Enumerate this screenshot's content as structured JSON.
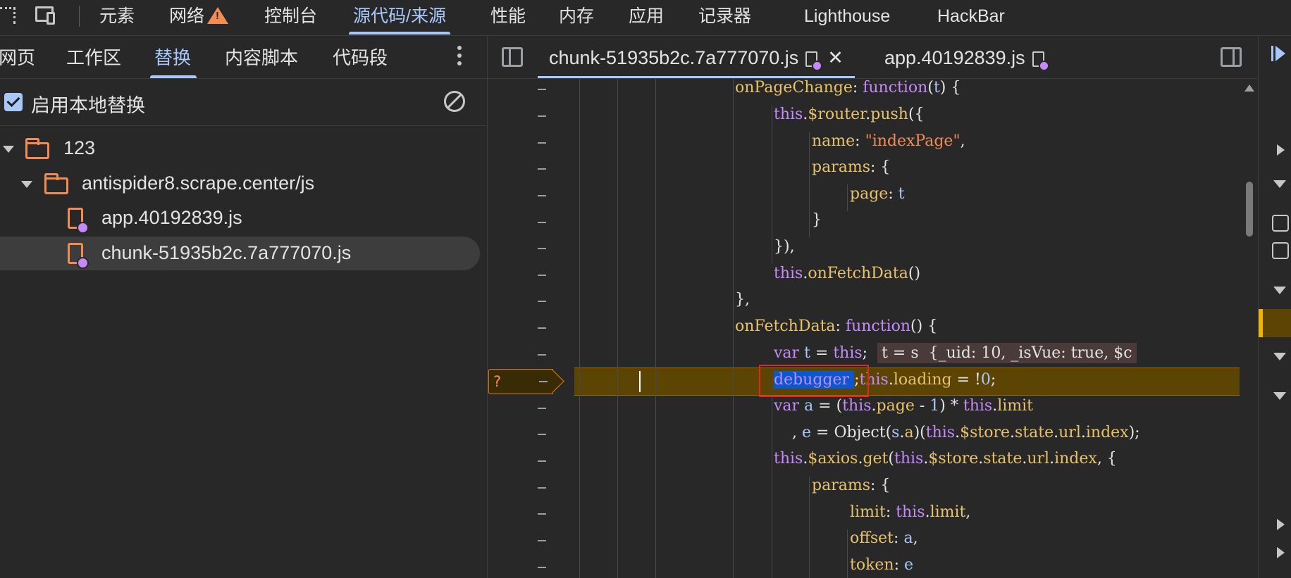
{
  "toolbar": {
    "tabs": [
      "元素",
      "网络",
      "控制台",
      "源代码/来源",
      "性能",
      "内存",
      "应用",
      "记录器",
      "Lighthouse",
      "HackBar"
    ],
    "active_tab": "源代码/来源",
    "network_has_warning": true
  },
  "navigator": {
    "tabs": [
      "网页",
      "工作区",
      "替换",
      "内容脚本",
      "代码段"
    ],
    "active_tab": "替换",
    "enable_label": "启用本地替换",
    "enable_checked": true,
    "tree": [
      {
        "label": "123",
        "type": "folder",
        "expanded": true
      },
      {
        "label": "antispider8.scrape.center/js",
        "type": "folder",
        "expanded": true
      },
      {
        "label": "app.40192839.js",
        "type": "file",
        "modified": true
      },
      {
        "label": "chunk-51935b2c.7a777070.js",
        "type": "file",
        "modified": true,
        "selected": true
      }
    ]
  },
  "editor": {
    "tabs": [
      {
        "label": "chunk-51935b2c.7a777070.js",
        "active": true,
        "closable": true
      },
      {
        "label": "app.40192839.js",
        "active": false,
        "closable": false
      }
    ],
    "gutter_mark": "?",
    "paused_line_index": 11,
    "inline_value_text": "t = s  {_uid: 10, _isVue: true, $c",
    "code_lines": [
      "onPageChange: function(t) {",
      "this.$router.push({",
      "name: \"indexPage\",",
      "params: {",
      "page: t",
      "}",
      "}),",
      "this.onFetchData()",
      "},",
      "onFetchData: function() {",
      "var t = this;",
      "debugger ;this.loading = !0;",
      "var a = (this.page - 1) * this.limit",
      ", e = Object(s.a)(this.$store.state.url.index);",
      "this.$axios.get(this.$store.state.url.index, {",
      "params: {",
      "limit: this.limit,",
      "offset: a,",
      "token: e"
    ]
  },
  "colors": {
    "background": "#282828",
    "accent": "#a8c7fa",
    "keyword": "#c58af9",
    "property": "#e8c26a",
    "string": "#f28b54",
    "paused_line_bg": "#5c4404",
    "annotation_box": "#e5261f"
  }
}
